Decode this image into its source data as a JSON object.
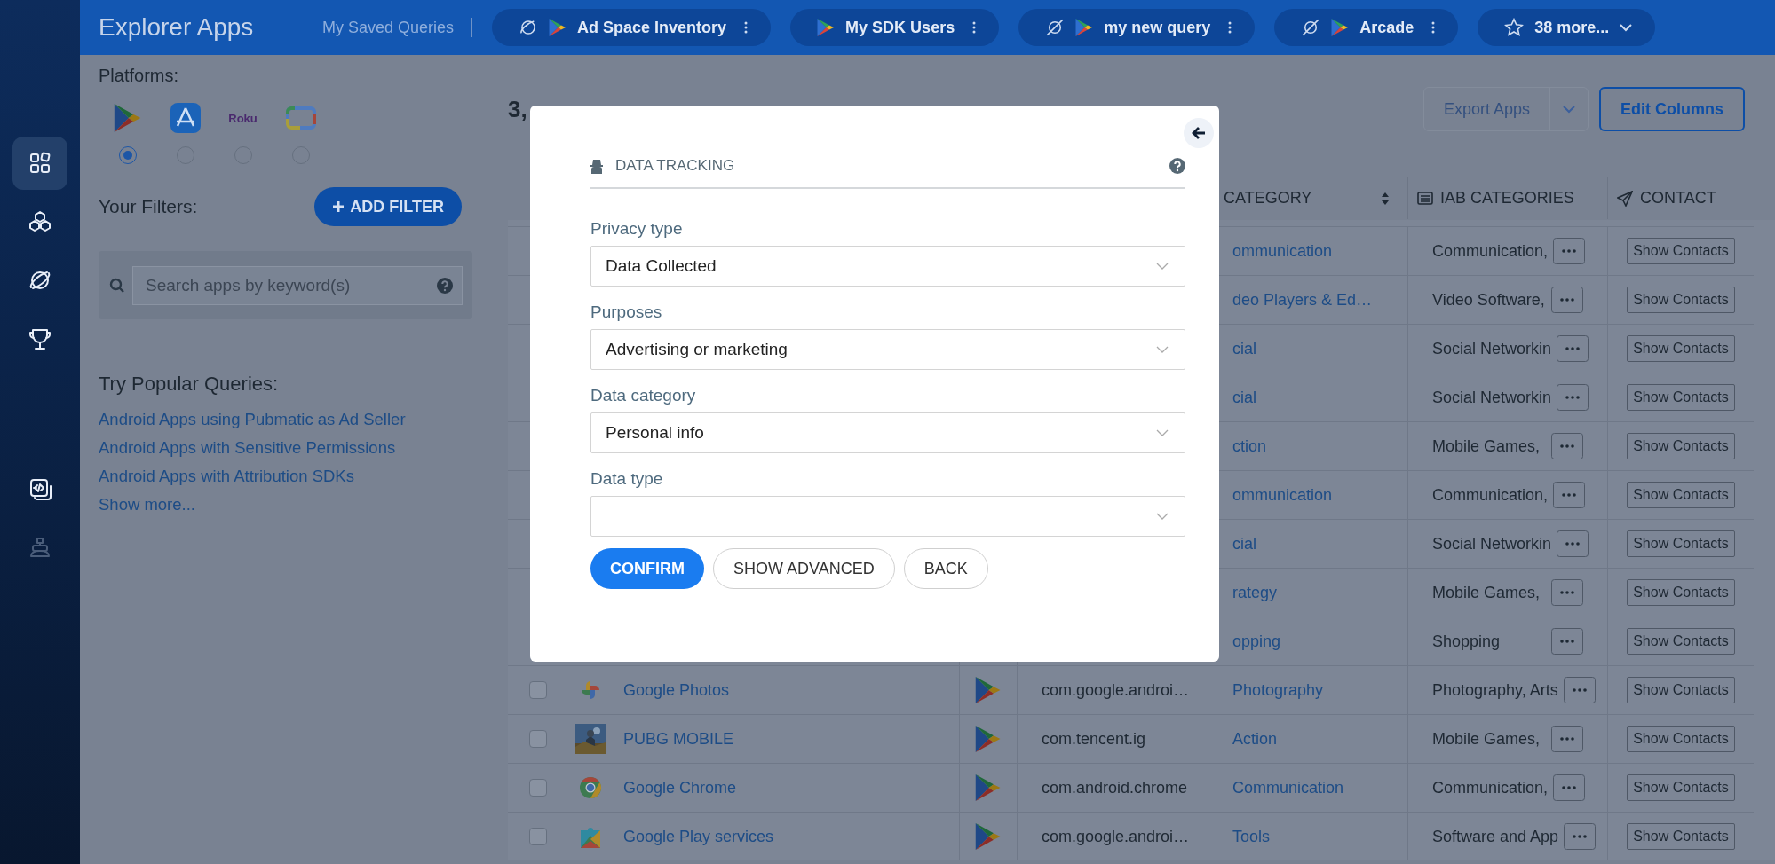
{
  "sidebar": {
    "items": [
      {
        "kind": "apps",
        "selected": true
      },
      {
        "kind": "cubes",
        "selected": false
      },
      {
        "kind": "orbit",
        "selected": false
      },
      {
        "kind": "trophy",
        "selected": false
      }
    ],
    "bottom_items": [
      {
        "kind": "code",
        "selected": false,
        "disabled": false
      },
      {
        "kind": "robot",
        "selected": false,
        "disabled": true
      }
    ]
  },
  "header": {
    "title": "Explorer Apps",
    "saved_label": "My Saved Queries",
    "queries": [
      {
        "kind": "orbit",
        "label": "Ad Space Inventory"
      },
      {
        "kind": "plain",
        "label": "My SDK Users"
      },
      {
        "kind": "slashed",
        "label": "my new query"
      },
      {
        "kind": "slashed",
        "label": "Arcade"
      }
    ],
    "more": {
      "label": "38 more..."
    }
  },
  "filters": {
    "platforms_label": "Platforms:",
    "platforms": [
      {
        "kind": "google_play",
        "selected": true
      },
      {
        "kind": "app_store",
        "selected": false
      },
      {
        "kind": "roku",
        "label": "Roku",
        "selected": false
      },
      {
        "kind": "tv",
        "selected": false
      }
    ],
    "your_filters_label": "Your Filters:",
    "add_filter": "ADD FILTER",
    "search": {
      "placeholder": "Search apps by keyword(s)"
    },
    "popular_title": "Try Popular Queries:",
    "popular": [
      "Android Apps using Pubmatic as Ad Seller",
      "Android Apps with Sensitive Permissions",
      "Android Apps with Attribution SDKs"
    ],
    "show_more": "Show more..."
  },
  "results": {
    "count": "3,",
    "export": {
      "label": "Export Apps",
      "disabled": true
    },
    "edit_columns": "Edit Columns"
  },
  "table": {
    "columns": [
      {
        "kind": "sortable",
        "label": "CATEGORY"
      },
      {
        "kind": "list",
        "label": "IAB CATEGORIES"
      },
      {
        "kind": "send",
        "label": "CONTACT"
      }
    ],
    "rows": [
      {
        "category": "ommunication",
        "iab": "Communication,",
        "contact": "Show Contacts"
      },
      {
        "category": "deo Players & Ed…",
        "iab": "Video Software,",
        "contact": "Show Contacts"
      },
      {
        "category": "cial",
        "iab": "Social Networkin",
        "contact": "Show Contacts"
      },
      {
        "category": "cial",
        "iab": "Social Networkin",
        "contact": "Show Contacts"
      },
      {
        "category": "ction",
        "iab": "Mobile Games,",
        "contact": "Show Contacts"
      },
      {
        "category": "ommunication",
        "iab": "Communication,",
        "contact": "Show Contacts"
      },
      {
        "category": "cial",
        "iab": "Social Networkin",
        "contact": "Show Contacts"
      },
      {
        "category": "rategy",
        "iab": "Mobile Games,",
        "contact": "Show Contacts"
      },
      {
        "category": "opping",
        "iab": "Shopping",
        "contact": "Show Contacts"
      },
      {
        "checked": false,
        "kind": "pinwheel",
        "name": "Google Photos",
        "package": "com.google.androi…",
        "category": "Photography",
        "iab": "Photography, Arts",
        "contact": "Show Contacts"
      },
      {
        "checked": false,
        "kind": "picture",
        "name": "PUBG MOBILE",
        "package": "com.tencent.ig",
        "category": "Action",
        "iab": "Mobile Games,",
        "contact": "Show Contacts"
      },
      {
        "checked": false,
        "kind": "browser",
        "name": "Google Chrome",
        "package": "com.android.chrome",
        "category": "Communication",
        "iab": "Communication,",
        "contact": "Show Contacts"
      },
      {
        "checked": false,
        "kind": "puzzle",
        "name": "Google Play services",
        "package": "com.google.androi…",
        "category": "Tools",
        "iab": "Software and App",
        "contact": "Show Contacts"
      }
    ]
  },
  "modal": {
    "title": "DATA TRACKING",
    "fields": [
      {
        "label": "Privacy type",
        "value": "Data Collected"
      },
      {
        "label": "Purposes",
        "value": "Advertising or marketing"
      },
      {
        "label": "Data category",
        "value": "Personal info"
      },
      {
        "label": "Data type"
      }
    ],
    "buttons": [
      {
        "kind": "primary",
        "label": "CONFIRM"
      },
      {
        "kind": "outline",
        "label": "SHOW ADVANCED"
      },
      {
        "kind": "outline",
        "label": "BACK"
      }
    ]
  }
}
